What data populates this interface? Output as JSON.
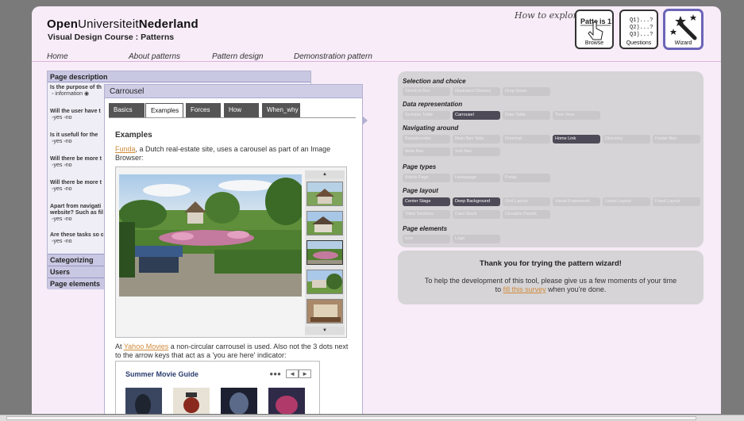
{
  "header": {
    "brand_bold1": "Open",
    "brand_bold2": "Universiteit",
    "brand_rest": "Nederland",
    "subtitle": "Visual Design Course : Patterns",
    "how_to_explore": "How to explore?"
  },
  "tools": {
    "browse_label": "Browse",
    "browse_icon_text": "Patte",
    "browse_icon_text2": "is 1:",
    "questions_label": "Questions",
    "questions_lines": [
      "Q1)...?",
      "Q2)...?",
      "Q3)...?"
    ],
    "wizard_label": "Wizard"
  },
  "nav": [
    "Home",
    "About patterns",
    "Pattern design",
    "Demonstration pattern"
  ],
  "left_panel": {
    "header": "Page description",
    "questions": [
      {
        "q": "Is the purpose of th",
        "opts": "information",
        "tail": ""
      },
      {
        "q": "Will the user have t",
        "opts": "yes",
        "tail": "no"
      },
      {
        "q": "Is it usefull for the",
        "opts": "yes",
        "tail": "no"
      },
      {
        "q": "Will there be more t",
        "opts": "yes",
        "tail": "no"
      },
      {
        "q": "Will there be more t",
        "opts": "yes",
        "tail": "no"
      },
      {
        "q": "Apart from navigati",
        "q2": "website? Such as fil",
        "opts": "yes",
        "tail": "no"
      },
      {
        "q": "Are these tasks so c",
        "opts": "yes",
        "tail": "no"
      }
    ],
    "accordions": [
      "Categorizing",
      "Users",
      "Page elements"
    ]
  },
  "carousel": {
    "title": "Carrousel",
    "tabs": [
      "Basics",
      "Examples",
      "Forces",
      "How",
      "When_why"
    ],
    "active_tab": 1,
    "examples_heading": "Examples",
    "p1_link": "Funda",
    "p1_text": ", a Dutch real-estate site, uses a carousel as part of an Image Browser:",
    "p2_prefix": "At ",
    "p2_link": "Yahoo Movies",
    "p2_text": " a non-circular carrousel is used. Also not the 3 dots next to the arrow keys that act as a 'you are here' indicator:",
    "movie_title": "Summer Movie Guide"
  },
  "wizard": {
    "categories": [
      {
        "name": "Selection and choice",
        "pills": [
          {
            "t": "Shortcut Box",
            "sel": false
          },
          {
            "t": "Illustrated Choices",
            "sel": false
          },
          {
            "t": "Drop Down",
            "sel": false
          }
        ]
      },
      {
        "name": "Data representation",
        "pills": [
          {
            "t": "Sortable Table",
            "sel": false
          },
          {
            "t": "Carrousel",
            "sel": true
          },
          {
            "t": "Data Table",
            "sel": false
          },
          {
            "t": "Tree View",
            "sel": false
          }
        ]
      },
      {
        "name": "Navigating around",
        "pills": [
          {
            "t": "Breadcrumbs",
            "sel": false
          },
          {
            "t": "Main Nav Tabs",
            "sel": false
          },
          {
            "t": "Doormat",
            "sel": false
          },
          {
            "t": "Home Link",
            "sel": true
          },
          {
            "t": "Directory",
            "sel": false
          },
          {
            "t": "Footer Nav",
            "sel": false
          },
          {
            "t": "Meta Nav",
            "sel": false
          },
          {
            "t": "Sub Nav",
            "sel": false
          }
        ]
      },
      {
        "name": "Page types",
        "pills": [
          {
            "t": "Article Page",
            "sel": false
          },
          {
            "t": "Homepage",
            "sel": false
          },
          {
            "t": "Portal",
            "sel": false
          }
        ]
      },
      {
        "name": "Page layout",
        "pills": [
          {
            "t": "Center Stage",
            "sel": true
          },
          {
            "t": "Deep Background",
            "sel": true
          },
          {
            "t": "Grid Layout",
            "sel": false
          },
          {
            "t": "Visual Framework",
            "sel": false
          },
          {
            "t": "Liquid Layout",
            "sel": false
          },
          {
            "t": "Fixed Layout",
            "sel": false
          },
          {
            "t": "Titled Sections",
            "sel": false
          },
          {
            "t": "Card Stack",
            "sel": false
          },
          {
            "t": "Closable Panels",
            "sel": false
          }
        ]
      },
      {
        "name": "Page elements",
        "pills": [
          {
            "t": "Icon",
            "sel": false
          },
          {
            "t": "Logo",
            "sel": false
          }
        ]
      }
    ]
  },
  "thanks": {
    "heading": "Thank you for trying the pattern wizard!",
    "text1": "To help the development of this tool, please give us a few moments of your time to ",
    "link": "fill this survey",
    "text2": " when you're done."
  },
  "colors": {
    "page_bg": "#f7ecf8",
    "panel_header": "#c9c8e3",
    "selected_pill": "#4e4a57",
    "link": "#d08a3a",
    "wizard_border": "#6b64b8"
  }
}
